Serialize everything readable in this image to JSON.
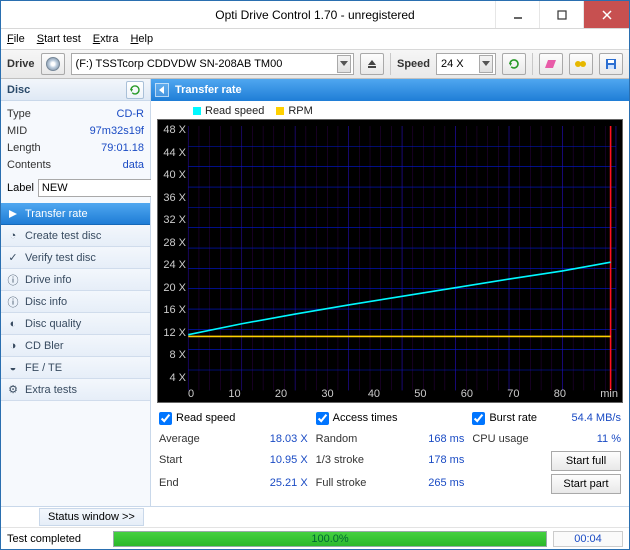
{
  "window": {
    "title": "Opti Drive Control 1.70 - unregistered"
  },
  "menu": {
    "file": "File",
    "start": "Start test",
    "extra": "Extra",
    "help": "Help"
  },
  "toolbar": {
    "drive_label": "Drive",
    "drive_value": "(F:)  TSSTcorp CDDVDW SN-208AB TM00",
    "speed_label": "Speed",
    "speed_value": "24 X"
  },
  "disc_panel": {
    "header": "Disc",
    "rows": {
      "type_k": "Type",
      "type_v": "CD-R",
      "mid_k": "MID",
      "mid_v": "97m32s19f",
      "length_k": "Length",
      "length_v": "79:01.18",
      "contents_k": "Contents",
      "contents_v": "data"
    },
    "label_k": "Label",
    "label_v": "NEW"
  },
  "nav": {
    "items": [
      "Transfer rate",
      "Create test disc",
      "Verify test disc",
      "Drive info",
      "Disc info",
      "Disc quality",
      "CD Bler",
      "FE / TE",
      "Extra tests"
    ]
  },
  "main": {
    "title": "Transfer rate",
    "legend": {
      "read": "Read speed",
      "rpm": "RPM"
    }
  },
  "chart_data": {
    "type": "line",
    "xlabel": "min",
    "xlim": [
      0,
      80
    ],
    "ylim": [
      0,
      52
    ],
    "y_ticks": [
      "48 X",
      "44 X",
      "40 X",
      "36 X",
      "32 X",
      "28 X",
      "24 X",
      "20 X",
      "16 X",
      "12 X",
      "8 X",
      "4 X"
    ],
    "x_ticks": [
      "0",
      "10",
      "20",
      "30",
      "40",
      "50",
      "60",
      "70",
      "80",
      "min"
    ],
    "series": [
      {
        "name": "Read speed",
        "color": "#00f8ff",
        "points": [
          [
            0,
            10.95
          ],
          [
            10,
            13.1
          ],
          [
            20,
            15.0
          ],
          [
            30,
            16.8
          ],
          [
            40,
            18.5
          ],
          [
            50,
            20.2
          ],
          [
            60,
            21.9
          ],
          [
            70,
            23.5
          ],
          [
            79,
            25.21
          ]
        ]
      },
      {
        "name": "RPM",
        "color": "#ffd000",
        "points": [
          [
            0,
            10.6
          ],
          [
            10,
            10.6
          ],
          [
            20,
            10.6
          ],
          [
            30,
            10.6
          ],
          [
            40,
            10.6
          ],
          [
            50,
            10.6
          ],
          [
            60,
            10.6
          ],
          [
            70,
            10.6
          ],
          [
            79,
            10.6
          ]
        ]
      }
    ],
    "marker_x": 79
  },
  "results": {
    "read_chk": "Read speed",
    "access_chk": "Access times",
    "burst_chk": "Burst rate",
    "burst_v": "54.4 MB/s",
    "avg_k": "Average",
    "avg_v": "18.03 X",
    "random_k": "Random",
    "random_v": "168 ms",
    "cpu_k": "CPU usage",
    "cpu_v": "11 %",
    "start_k": "Start",
    "start_v": "10.95 X",
    "third_k": "1/3 stroke",
    "third_v": "178 ms",
    "btn_full": "Start full",
    "end_k": "End",
    "end_v": "25.21 X",
    "full_k": "Full stroke",
    "full_v": "265 ms",
    "btn_part": "Start part"
  },
  "footer": {
    "status_btn": "Status window >>",
    "completed": "Test completed",
    "percent": "100.0%",
    "elapsed": "00:04"
  }
}
